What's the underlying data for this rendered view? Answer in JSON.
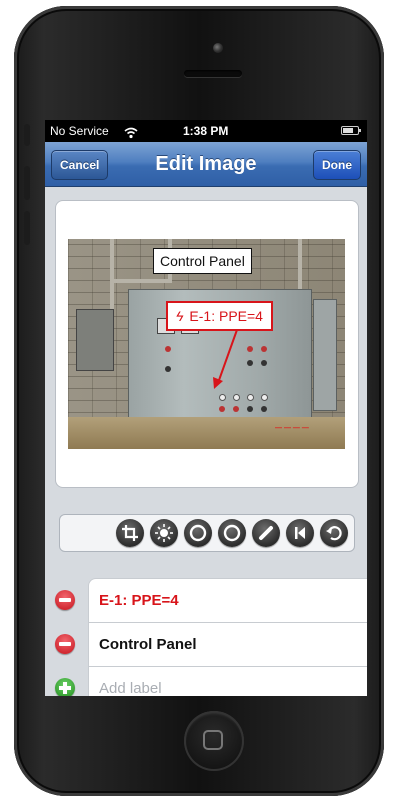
{
  "status_bar": {
    "carrier": "No Service",
    "time": "1:38 PM"
  },
  "nav": {
    "title": "Edit Image",
    "cancel_label": "Cancel",
    "done_label": "Done"
  },
  "image": {
    "annotations": [
      {
        "text": "Control Panel",
        "color": "#111111"
      },
      {
        "text": "E-1: PPE=4",
        "color": "#d8141a"
      }
    ]
  },
  "toolbar": {
    "tools": [
      "crop-icon",
      "brightness-icon",
      "rotate-left-icon",
      "rotate-right-icon",
      "draw-icon",
      "skip-back-icon",
      "undo-icon"
    ]
  },
  "labels": {
    "items": [
      {
        "text": "E-1: PPE=4",
        "color": "#d8141a"
      },
      {
        "text": "Control Panel",
        "color": "#111111"
      }
    ],
    "add_placeholder": "Add label"
  },
  "colors": {
    "nav_blue": "#3a6cb2",
    "accent_red": "#d8141a",
    "add_green": "#1e8a1a"
  }
}
